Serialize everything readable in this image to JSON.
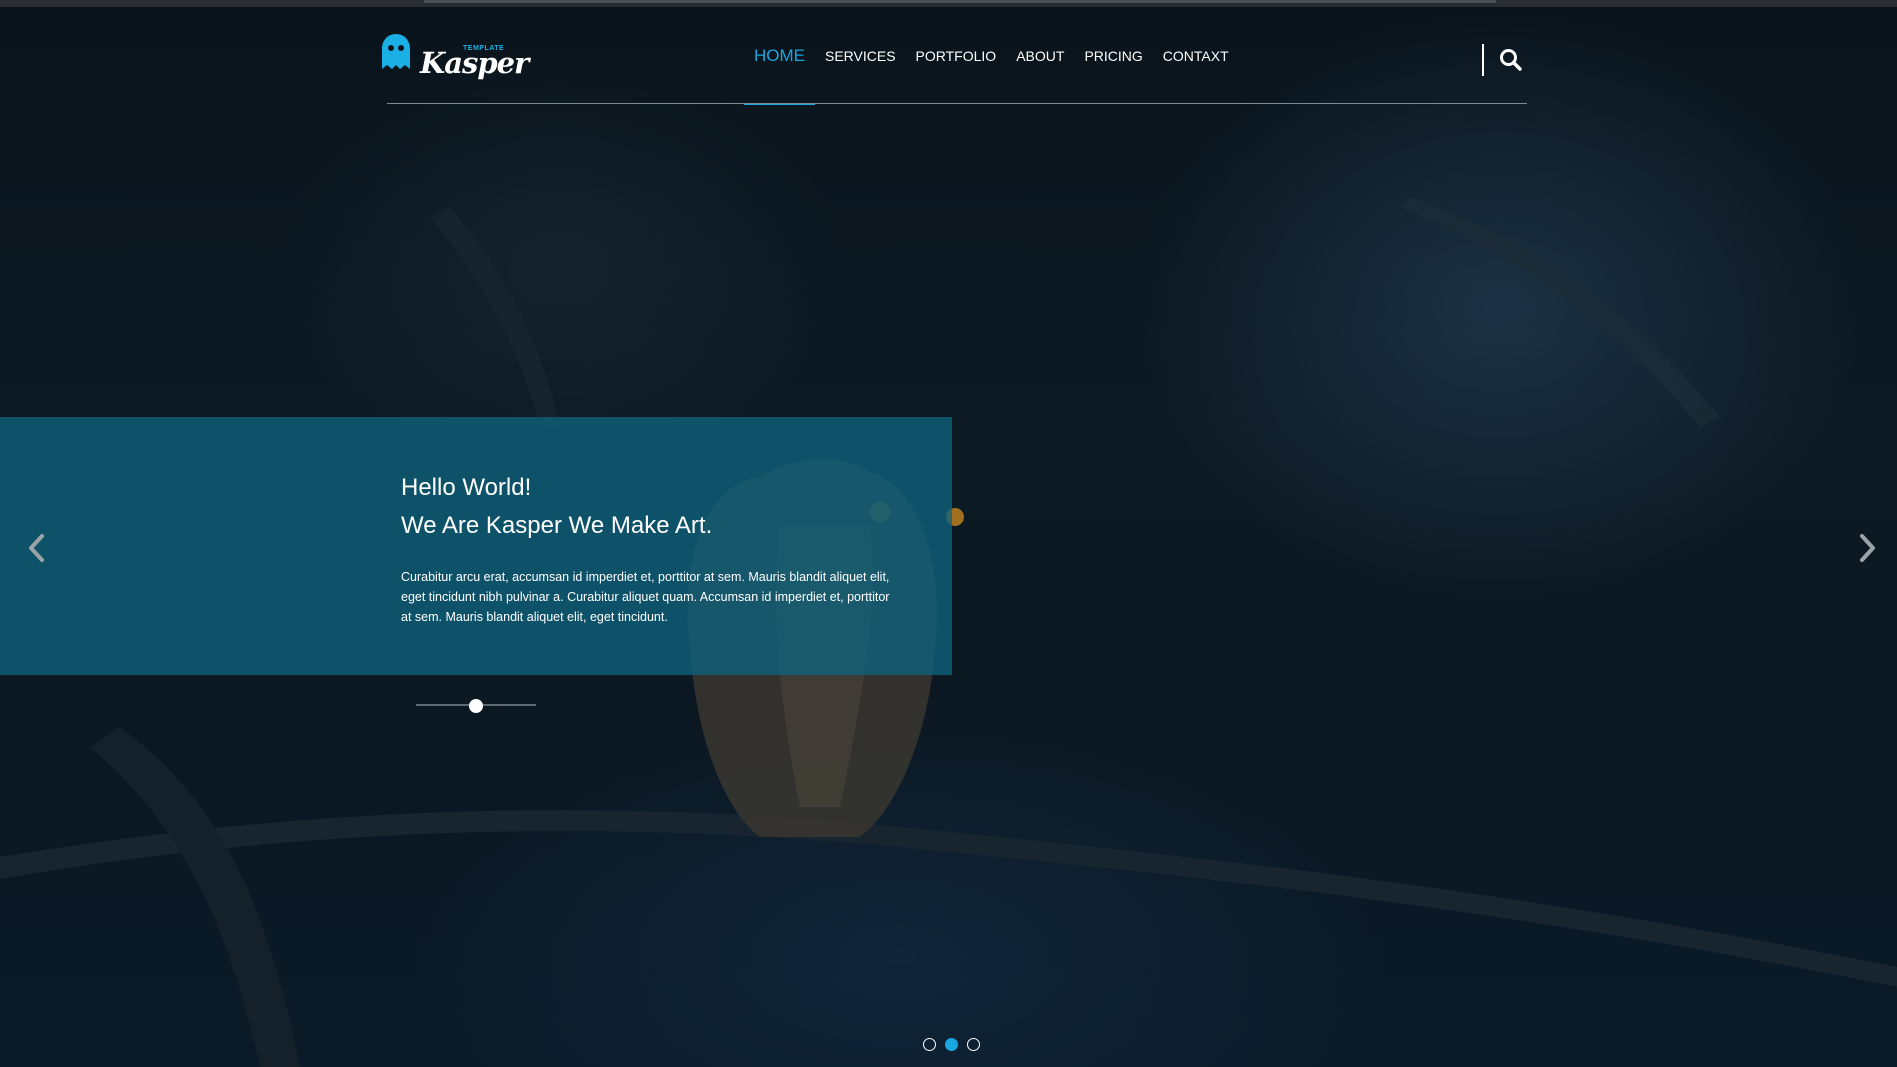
{
  "brand": {
    "name": "Kasper",
    "tag": "TEMPLATE",
    "accent": "#1aa6e0"
  },
  "nav": {
    "items": [
      {
        "label": "HOME",
        "active": true
      },
      {
        "label": "SERVICES",
        "active": false
      },
      {
        "label": "PORTFOLIO",
        "active": false
      },
      {
        "label": "ABOUT",
        "active": false
      },
      {
        "label": "PRICING",
        "active": false
      },
      {
        "label": "CONTAXT",
        "active": false
      }
    ],
    "search_icon": "search-icon"
  },
  "hero": {
    "title_line1": "Hello World!",
    "title_line2": "We Are Kasper We Make Art.",
    "body": "Curabitur arcu erat, accumsan id imperdiet et, porttitor at sem. Mauris blandit aliquet elit, eget tincidunt nibh pulvinar a. Curabitur aliquet quam. Accumsan id imperdiet et, porttitor at sem. Mauris blandit aliquet elit, eget tincidunt.",
    "caption_color": "#0f637d",
    "slider_value": 0.5,
    "prev_icon": "chevron-left-icon",
    "next_icon": "chevron-right-icon"
  },
  "carousel": {
    "slide_count": 3,
    "active_index": 1
  }
}
